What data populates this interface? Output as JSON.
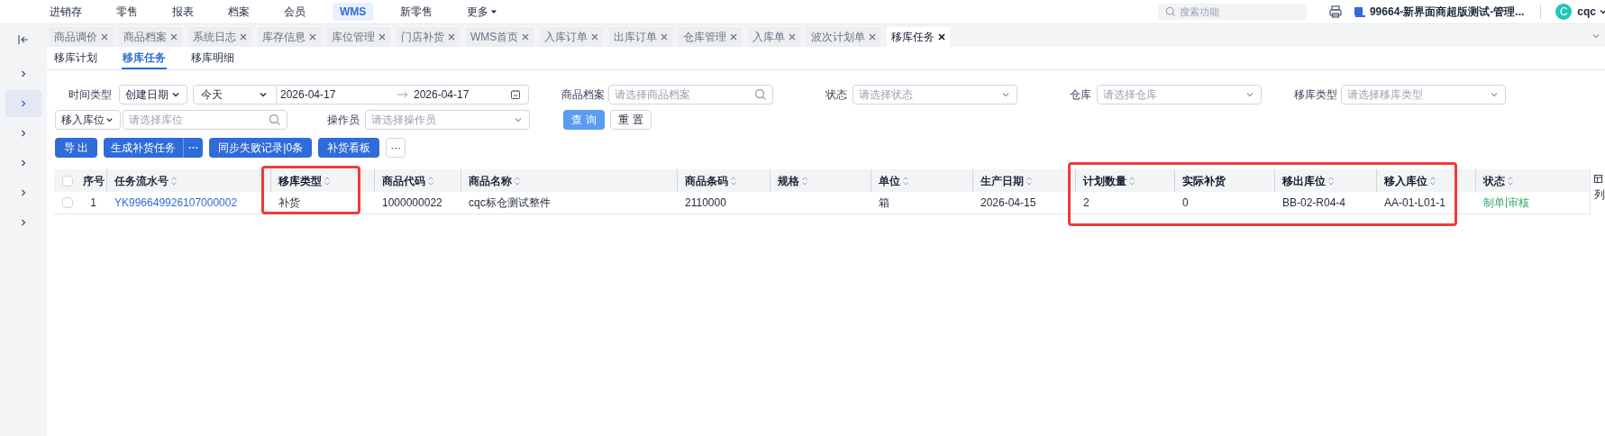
{
  "top_nav": {
    "items": [
      {
        "label": "进销存",
        "selected": false
      },
      {
        "label": "零售",
        "selected": false
      },
      {
        "label": "报表",
        "selected": false
      },
      {
        "label": "档案",
        "selected": false
      },
      {
        "label": "会员",
        "selected": false
      },
      {
        "label": "WMS",
        "selected": true
      },
      {
        "label": "新零售",
        "selected": false
      },
      {
        "label": "更多",
        "selected": false,
        "dropdown": true
      }
    ],
    "search": {
      "placeholder": "搜索功能"
    },
    "store": "99664-新界面商超版测试-管理...",
    "avatar": "C",
    "user": "cqc"
  },
  "sidebar": {
    "items": [
      {
        "selected": false
      },
      {
        "selected": true
      },
      {
        "selected": false
      },
      {
        "selected": false
      },
      {
        "selected": false
      },
      {
        "selected": false
      }
    ]
  },
  "page_tabs": [
    {
      "label": "商品调价",
      "selected": false
    },
    {
      "label": "商品档案",
      "selected": false
    },
    {
      "label": "系统日志",
      "selected": false
    },
    {
      "label": "库存信息",
      "selected": false
    },
    {
      "label": "库位管理",
      "selected": false
    },
    {
      "label": "门店补货",
      "selected": false
    },
    {
      "label": "WMS首页",
      "selected": false
    },
    {
      "label": "入库订单",
      "selected": false
    },
    {
      "label": "出库订单",
      "selected": false
    },
    {
      "label": "仓库管理",
      "selected": false
    },
    {
      "label": "入库单",
      "selected": false
    },
    {
      "label": "波次计划单",
      "selected": false
    },
    {
      "label": "移库任务",
      "selected": true
    }
  ],
  "sub_tabs": [
    {
      "label": "移库计划",
      "selected": false
    },
    {
      "label": "移库任务",
      "selected": true
    },
    {
      "label": "移库明细",
      "selected": false
    }
  ],
  "filters": {
    "time_type": {
      "label": "时间类型",
      "value": "创建日期"
    },
    "period": "今天",
    "date_from": "2026-04-17",
    "date_to": "2026-04-17",
    "fields": [
      {
        "label": "商品档案",
        "placeholder": "请选择商品档案",
        "kind": "search"
      },
      {
        "label": "状态",
        "placeholder": "请选择状态",
        "kind": "select"
      },
      {
        "label": "仓库",
        "placeholder": "请选择仓库",
        "kind": "select"
      },
      {
        "label": "移库类型",
        "placeholder": "请选择移库类型",
        "kind": "select"
      }
    ],
    "location": {
      "value": "移入库位",
      "placeholder": "请选择库位"
    },
    "operator": {
      "label": "操作员",
      "placeholder": "请选择操作员"
    },
    "query": "查 询",
    "reset": "重 置"
  },
  "actions": [
    {
      "label": "导 出",
      "kind": "plain"
    },
    {
      "label": "生成补货任务",
      "kind": "split"
    },
    {
      "label": "同步失败记录|0条",
      "kind": "plain"
    },
    {
      "label": "补货看板",
      "kind": "plain"
    },
    {
      "label": "···",
      "kind": "more"
    }
  ],
  "table": {
    "columns": [
      {
        "label": "序号",
        "sortable": false,
        "highlighted": false
      },
      {
        "label": "任务流水号",
        "sortable": true,
        "highlighted": false
      },
      {
        "label": "移库类型",
        "sortable": true,
        "highlighted": true
      },
      {
        "label": "商品代码",
        "sortable": true,
        "highlighted": false
      },
      {
        "label": "商品名称",
        "sortable": true,
        "highlighted": false
      },
      {
        "label": "商品条码",
        "sortable": true,
        "highlighted": false
      },
      {
        "label": "规格",
        "sortable": true,
        "highlighted": false
      },
      {
        "label": "单位",
        "sortable": true,
        "highlighted": false
      },
      {
        "label": "生产日期",
        "sortable": true,
        "highlighted": false
      },
      {
        "label": "计划数量",
        "sortable": true,
        "highlighted": true
      },
      {
        "label": "实际补货",
        "sortable": false,
        "highlighted": true
      },
      {
        "label": "移出库位",
        "sortable": true,
        "highlighted": true
      },
      {
        "label": "移入库位",
        "sortable": true,
        "highlighted": true
      },
      {
        "label": "状态",
        "sortable": true,
        "highlighted": false
      }
    ],
    "rows": [
      {
        "checked": false,
        "cells": [
          "1",
          "YK996649926107000002",
          "补货",
          "1000000022",
          "cqc标仓测试整件",
          "2110000",
          "",
          "箱",
          "2026-04-15",
          "2",
          "0",
          "BB-02-R04-4",
          "AA-01-L01-1"
        ],
        "actions": [
          "制单",
          "审核"
        ]
      }
    ],
    "column_settings": "列",
    "header_checked": false
  }
}
